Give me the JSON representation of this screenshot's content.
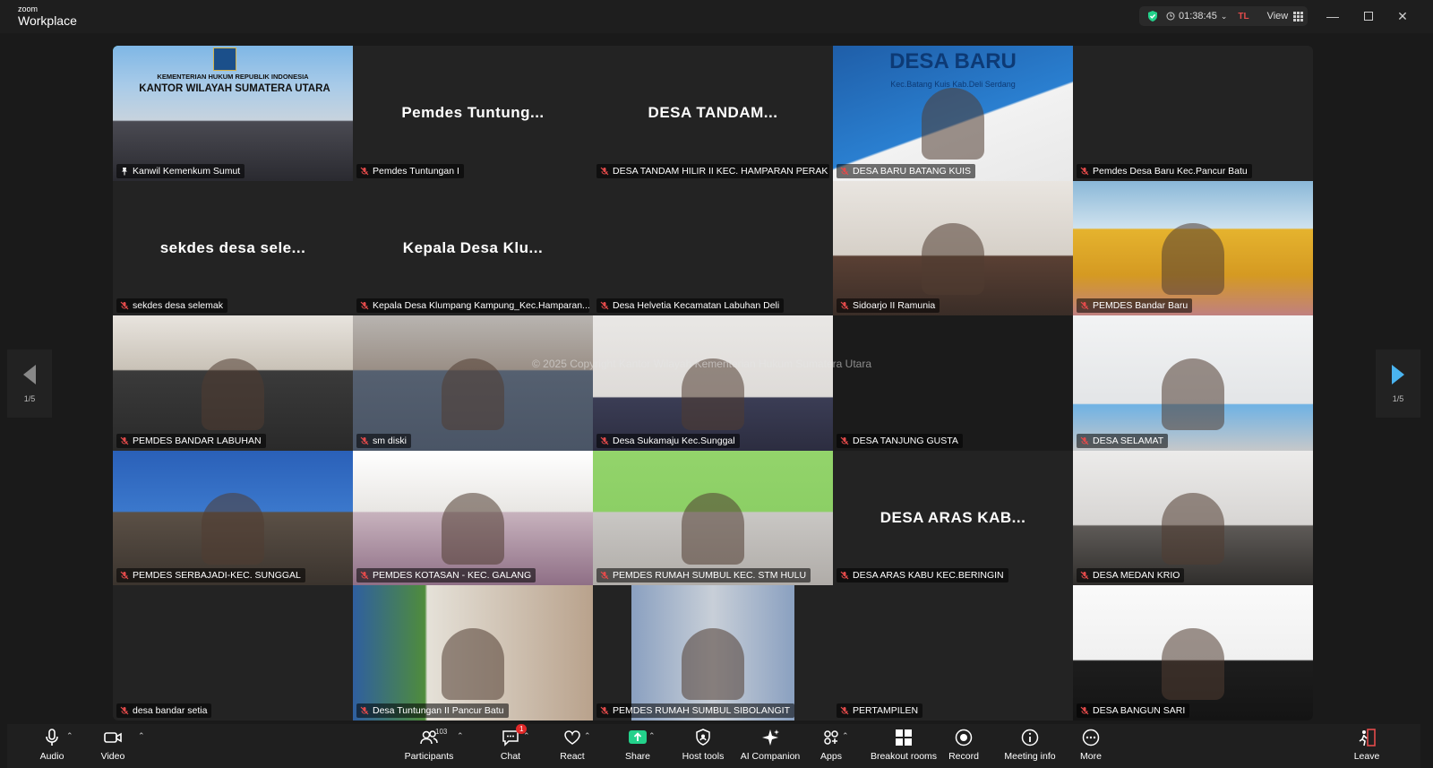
{
  "app": {
    "brand_small": "zoom",
    "brand_big": "Workplace"
  },
  "status": {
    "timer": "01:38:45",
    "user_initials": "TL",
    "view_label": "View"
  },
  "watermark": "© 2025 Copyright Kantor Wilayah Kementerian Hukum Sumatera Utara",
  "pager": {
    "left_label": "1/5",
    "right_label": "1/5"
  },
  "tiles": [
    {
      "name": "Kanwil Kemenkum Sumut",
      "big": "",
      "kind": "banner",
      "banner_line1": "KEMENTERIAN HUKUM REPUBLIK INDONESIA",
      "banner_line2": "KANTOR WILAYAH SUMATERA UTARA"
    },
    {
      "name": "Pemdes Tuntungan I",
      "big": "Pemdes  Tuntung...",
      "kind": "name"
    },
    {
      "name": "DESA TANDAM HILIR II KEC. HAMPARAN PERAK",
      "big": "DESA  TANDAM...",
      "kind": "name"
    },
    {
      "name": "DESA BARU BATANG KUIS",
      "big": "",
      "kind": "video",
      "banner_line1": "DESA BARU",
      "banner_line2": "Kec.Batang Kuis Kab.Deli Serdang"
    },
    {
      "name": "Pemdes Desa Baru Kec.Pancur Batu",
      "big": "",
      "kind": "blank"
    },
    {
      "name": "sekdes desa selemak",
      "big": "sekdes desa sele...",
      "kind": "name"
    },
    {
      "name": "Kepala Desa Klumpang Kampung_Kec.Hamparan...",
      "big": "Kepala Desa Klu...",
      "kind": "name"
    },
    {
      "name": "Desa Helvetia Kecamatan Labuhan Deli",
      "big": "",
      "kind": "blank"
    },
    {
      "name": "Sidoarjo II Ramunia",
      "big": "",
      "kind": "video"
    },
    {
      "name": "PEMDES Bandar Baru",
      "big": "",
      "kind": "video"
    },
    {
      "name": "PEMDES BANDAR LABUHAN",
      "big": "",
      "kind": "video"
    },
    {
      "name": "sm diski",
      "big": "",
      "kind": "video"
    },
    {
      "name": "Desa Sukamaju Kec.Sunggal",
      "big": "",
      "kind": "video"
    },
    {
      "name": "DESA TANJUNG GUSTA",
      "big": "",
      "kind": "black"
    },
    {
      "name": "DESA SELAMAT",
      "big": "",
      "kind": "video"
    },
    {
      "name": "PEMDES SERBAJADI-KEC. SUNGGAL",
      "big": "",
      "kind": "video"
    },
    {
      "name": "PEMDES KOTASAN - KEC. GALANG",
      "big": "",
      "kind": "video"
    },
    {
      "name": "PEMDES RUMAH SUMBUL KEC. STM HULU",
      "big": "",
      "kind": "video"
    },
    {
      "name": "DESA ARAS KABU KEC.BERINGIN",
      "big": "DESA  ARAS  KAB...",
      "kind": "name"
    },
    {
      "name": "DESA MEDAN KRIO",
      "big": "",
      "kind": "video"
    },
    {
      "name": "desa bandar setia",
      "big": "",
      "kind": "blank"
    },
    {
      "name": "Desa Tuntungan II Pancur Batu",
      "big": "",
      "kind": "video"
    },
    {
      "name": "PEMDES RUMAH SUMBUL SIBOLANGIT",
      "big": "",
      "kind": "video"
    },
    {
      "name": "PERTAMPILEN",
      "big": "",
      "kind": "blank"
    },
    {
      "name": "DESA BANGUN SARI",
      "big": "",
      "kind": "video"
    }
  ],
  "toolbar": {
    "audio": "Audio",
    "video": "Video",
    "participants": "Participants",
    "participants_count": "103",
    "chat": "Chat",
    "chat_badge": "1",
    "react": "React",
    "share": "Share",
    "host_tools": "Host tools",
    "ai_companion": "AI Companion",
    "apps": "Apps",
    "breakout_rooms": "Breakout rooms",
    "record": "Record",
    "meeting_info": "Meeting info",
    "more": "More",
    "leave": "Leave"
  },
  "colors": {
    "active_border": "#23d18b",
    "share_green": "#23d18b",
    "mute_red": "#e34b4b",
    "pager_arrow": "#4ab4f0"
  }
}
